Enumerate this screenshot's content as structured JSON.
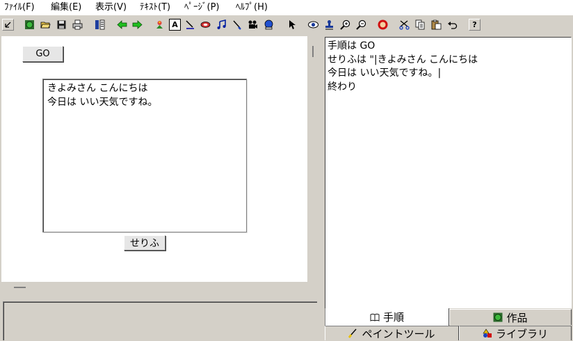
{
  "menu": [
    {
      "id": "file",
      "label": "ﾌｧｲﾙ(F)"
    },
    {
      "id": "edit",
      "label": "編集(E)"
    },
    {
      "id": "view",
      "label": "表示(V)"
    },
    {
      "id": "text",
      "label": "ﾃｷｽﾄ(T)"
    },
    {
      "id": "page",
      "label": "ﾍﾟｰｼﾞ(P)"
    },
    {
      "id": "help",
      "label": "ﾍﾙﾌﾟ(H)"
    }
  ],
  "toolbar": {
    "font_button_glyph": "A",
    "help_button_glyph": "?",
    "icons": [
      "restore-icon",
      "world-icon",
      "open-folder-icon",
      "save-icon",
      "print-icon",
      "page-list-icon",
      "back-arrow-icon",
      "forward-arrow-icon",
      "paint-icon",
      "font-icon",
      "pen-icon",
      "eraser-icon",
      "music-note-icon",
      "brush-icon",
      "movie-camera-icon",
      "globe-link-icon",
      "pointer-icon",
      "eye-icon",
      "stamp-icon",
      "zoom-in-icon",
      "zoom-out-icon",
      "stop-hand-icon",
      "cut-icon",
      "copy-icon",
      "paste-icon",
      "undo-icon",
      "help-icon"
    ]
  },
  "canvas": {
    "go_button_label": "GO",
    "speech_box_lines": [
      "きよみさん こんにちは",
      "今日は いい天気ですね。"
    ],
    "speech_button_label": "せりふ"
  },
  "script": {
    "lines": [
      "手順は GO",
      "せりふは \"|きよみさん こんにちは",
      "今日は いい天気ですね。|",
      "終わり"
    ]
  },
  "tabs": [
    {
      "id": "script",
      "label": "手順",
      "selected": true
    },
    {
      "id": "works",
      "label": "作品",
      "selected": false
    },
    {
      "id": "paint",
      "label": "ペイントツール",
      "selected": false
    },
    {
      "id": "library",
      "label": "ライブラリ",
      "selected": false
    }
  ]
}
